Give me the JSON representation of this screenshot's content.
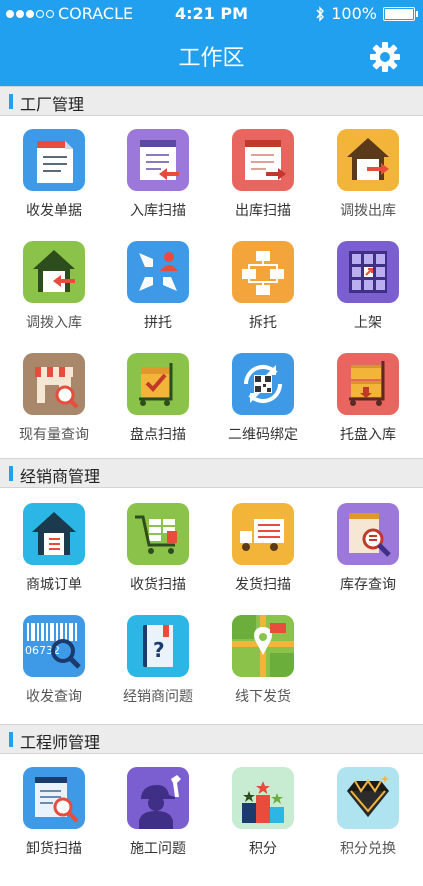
{
  "status": {
    "carrier": "CORACLE",
    "time": "4:21 PM",
    "battery": "100%"
  },
  "nav": {
    "title": "工作区"
  },
  "sections": [
    {
      "title": "工厂管理",
      "items": [
        "收发单据",
        "入库扫描",
        "出库扫描",
        "调拨出库",
        "调拨入库",
        "拼托",
        "拆托",
        "上架",
        "现有量查询",
        "盘点扫描",
        "二维码绑定",
        "托盘入库"
      ]
    },
    {
      "title": "经销商管理",
      "items": [
        "商城订单",
        "收货扫描",
        "发货扫描",
        "库存查询",
        "收发查询",
        "经销商问题",
        "线下发货"
      ]
    },
    {
      "title": "工程师管理",
      "items": [
        "卸货扫描",
        "施工问题",
        "积分",
        "积分兑换"
      ]
    }
  ],
  "icons": {
    "s0i0": "document-icon",
    "s0i1": "stock-in-scan-icon",
    "s0i2": "stock-out-scan-icon",
    "s0i3": "transfer-out-icon",
    "s0i4": "transfer-in-icon",
    "s0i5": "merge-pallet-icon",
    "s0i6": "split-pallet-icon",
    "s0i7": "shelving-icon",
    "s0i8": "inventory-query-icon",
    "s0i9": "stocktake-icon",
    "s0i10": "qrcode-bind-icon",
    "s0i11": "pallet-in-icon",
    "s1i0": "mall-order-icon",
    "s1i1": "receive-scan-icon",
    "s1i2": "ship-scan-icon",
    "s1i3": "stock-query-icon",
    "s1i4": "barcode-query-icon",
    "s1i5": "dealer-question-icon",
    "s1i6": "map-pin-icon",
    "s2i0": "unload-scan-icon",
    "s2i1": "worker-icon",
    "s2i2": "podium-icon",
    "s2i3": "diamond-icon"
  },
  "text_strings": {
    "barcode_digits": "06732"
  }
}
